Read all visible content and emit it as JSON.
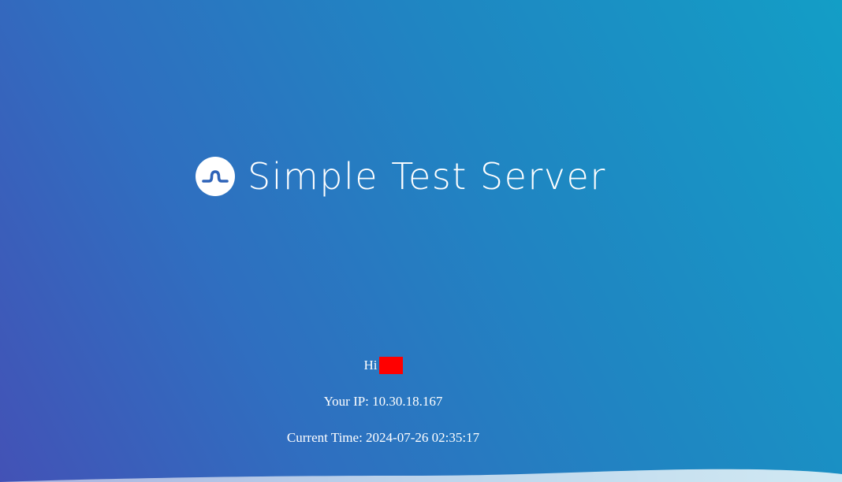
{
  "header": {
    "logo_icon": "wave-logo-icon",
    "title": "Simple Test Server"
  },
  "info": {
    "greeting": "Hi",
    "ip_text": "Your IP: 10.30.18.167",
    "time_text": "Current Time: 2024-07-26 02:35:17"
  },
  "colors": {
    "background_start": "#4352b6",
    "background_end": "#139ec6",
    "text": "#ffffff",
    "redaction": "#ff0000"
  }
}
